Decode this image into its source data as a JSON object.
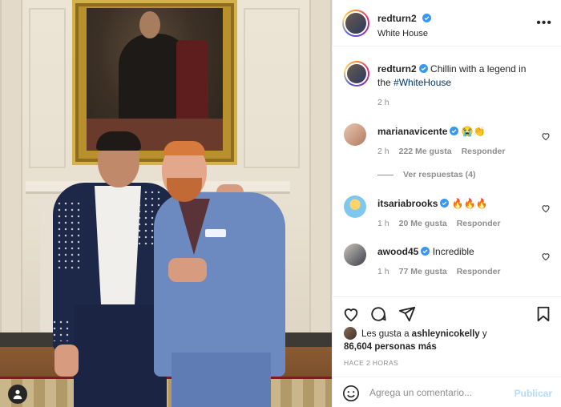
{
  "post": {
    "username": "redturn2",
    "location": "White House",
    "caption": "Chillin with a legend in the",
    "hashtag": "#WhiteHouse",
    "time": "2 h"
  },
  "comments": [
    {
      "user": "marianavicente",
      "verified": true,
      "text": "😭👏",
      "time": "2 h",
      "likes": "222 Me gusta",
      "reply": "Responder"
    },
    {
      "user": "itsariabrooks",
      "verified": true,
      "text": "🔥🔥🔥",
      "time": "1 h",
      "likes": "20 Me gusta",
      "reply": "Responder"
    },
    {
      "user": "awood45",
      "verified": true,
      "text": "Incredible",
      "time": "1 h",
      "likes": "77 Me gusta",
      "reply": "Responder"
    }
  ],
  "view_replies": "Ver respuestas (4)",
  "likes": {
    "prefix": "Les gusta a",
    "user": "ashleynicokelly",
    "suffix": "y",
    "count_line": "86,604 personas más"
  },
  "posted_ago": "HACE 2 HORAS",
  "composer": {
    "placeholder": "Agrega un comentario...",
    "publish": "Publicar"
  },
  "icons": {
    "more": "more-options-icon",
    "like": "heart-icon",
    "comment": "comment-icon",
    "share": "paper-plane-icon",
    "save": "bookmark-icon",
    "emoji": "emoji-icon",
    "user_tag": "person-icon"
  },
  "colors": {
    "verified": "#3897f0",
    "hashtag": "#00376b",
    "muted": "#8e8e8e",
    "publish": "#b3dbff"
  }
}
